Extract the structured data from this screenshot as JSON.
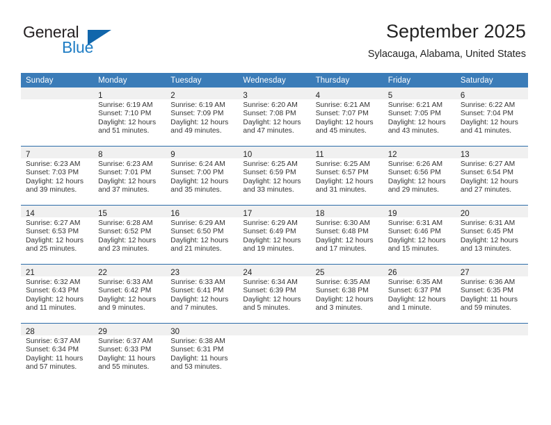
{
  "brand": {
    "name_top": "General",
    "name_bottom": "Blue",
    "accent_color": "#1166ab",
    "text_color": "#231f20"
  },
  "header": {
    "title": "September 2025",
    "location": "Sylacauga, Alabama, United States"
  },
  "theme": {
    "header_row_bg": "#3b7cb8",
    "row_divider": "#2a6ba8",
    "daynum_band_bg": "#f0f0f0",
    "body_text": "#333333"
  },
  "weekday_headers": [
    "Sunday",
    "Monday",
    "Tuesday",
    "Wednesday",
    "Thursday",
    "Friday",
    "Saturday"
  ],
  "weeks": [
    [
      {
        "day": "",
        "sunrise": "",
        "sunset": "",
        "daylight_1": "",
        "daylight_2": ""
      },
      {
        "day": "1",
        "sunrise": "Sunrise: 6:19 AM",
        "sunset": "Sunset: 7:10 PM",
        "daylight_1": "Daylight: 12 hours",
        "daylight_2": "and 51 minutes."
      },
      {
        "day": "2",
        "sunrise": "Sunrise: 6:19 AM",
        "sunset": "Sunset: 7:09 PM",
        "daylight_1": "Daylight: 12 hours",
        "daylight_2": "and 49 minutes."
      },
      {
        "day": "3",
        "sunrise": "Sunrise: 6:20 AM",
        "sunset": "Sunset: 7:08 PM",
        "daylight_1": "Daylight: 12 hours",
        "daylight_2": "and 47 minutes."
      },
      {
        "day": "4",
        "sunrise": "Sunrise: 6:21 AM",
        "sunset": "Sunset: 7:07 PM",
        "daylight_1": "Daylight: 12 hours",
        "daylight_2": "and 45 minutes."
      },
      {
        "day": "5",
        "sunrise": "Sunrise: 6:21 AM",
        "sunset": "Sunset: 7:05 PM",
        "daylight_1": "Daylight: 12 hours",
        "daylight_2": "and 43 minutes."
      },
      {
        "day": "6",
        "sunrise": "Sunrise: 6:22 AM",
        "sunset": "Sunset: 7:04 PM",
        "daylight_1": "Daylight: 12 hours",
        "daylight_2": "and 41 minutes."
      }
    ],
    [
      {
        "day": "7",
        "sunrise": "Sunrise: 6:23 AM",
        "sunset": "Sunset: 7:03 PM",
        "daylight_1": "Daylight: 12 hours",
        "daylight_2": "and 39 minutes."
      },
      {
        "day": "8",
        "sunrise": "Sunrise: 6:23 AM",
        "sunset": "Sunset: 7:01 PM",
        "daylight_1": "Daylight: 12 hours",
        "daylight_2": "and 37 minutes."
      },
      {
        "day": "9",
        "sunrise": "Sunrise: 6:24 AM",
        "sunset": "Sunset: 7:00 PM",
        "daylight_1": "Daylight: 12 hours",
        "daylight_2": "and 35 minutes."
      },
      {
        "day": "10",
        "sunrise": "Sunrise: 6:25 AM",
        "sunset": "Sunset: 6:59 PM",
        "daylight_1": "Daylight: 12 hours",
        "daylight_2": "and 33 minutes."
      },
      {
        "day": "11",
        "sunrise": "Sunrise: 6:25 AM",
        "sunset": "Sunset: 6:57 PM",
        "daylight_1": "Daylight: 12 hours",
        "daylight_2": "and 31 minutes."
      },
      {
        "day": "12",
        "sunrise": "Sunrise: 6:26 AM",
        "sunset": "Sunset: 6:56 PM",
        "daylight_1": "Daylight: 12 hours",
        "daylight_2": "and 29 minutes."
      },
      {
        "day": "13",
        "sunrise": "Sunrise: 6:27 AM",
        "sunset": "Sunset: 6:54 PM",
        "daylight_1": "Daylight: 12 hours",
        "daylight_2": "and 27 minutes."
      }
    ],
    [
      {
        "day": "14",
        "sunrise": "Sunrise: 6:27 AM",
        "sunset": "Sunset: 6:53 PM",
        "daylight_1": "Daylight: 12 hours",
        "daylight_2": "and 25 minutes."
      },
      {
        "day": "15",
        "sunrise": "Sunrise: 6:28 AM",
        "sunset": "Sunset: 6:52 PM",
        "daylight_1": "Daylight: 12 hours",
        "daylight_2": "and 23 minutes."
      },
      {
        "day": "16",
        "sunrise": "Sunrise: 6:29 AM",
        "sunset": "Sunset: 6:50 PM",
        "daylight_1": "Daylight: 12 hours",
        "daylight_2": "and 21 minutes."
      },
      {
        "day": "17",
        "sunrise": "Sunrise: 6:29 AM",
        "sunset": "Sunset: 6:49 PM",
        "daylight_1": "Daylight: 12 hours",
        "daylight_2": "and 19 minutes."
      },
      {
        "day": "18",
        "sunrise": "Sunrise: 6:30 AM",
        "sunset": "Sunset: 6:48 PM",
        "daylight_1": "Daylight: 12 hours",
        "daylight_2": "and 17 minutes."
      },
      {
        "day": "19",
        "sunrise": "Sunrise: 6:31 AM",
        "sunset": "Sunset: 6:46 PM",
        "daylight_1": "Daylight: 12 hours",
        "daylight_2": "and 15 minutes."
      },
      {
        "day": "20",
        "sunrise": "Sunrise: 6:31 AM",
        "sunset": "Sunset: 6:45 PM",
        "daylight_1": "Daylight: 12 hours",
        "daylight_2": "and 13 minutes."
      }
    ],
    [
      {
        "day": "21",
        "sunrise": "Sunrise: 6:32 AM",
        "sunset": "Sunset: 6:43 PM",
        "daylight_1": "Daylight: 12 hours",
        "daylight_2": "and 11 minutes."
      },
      {
        "day": "22",
        "sunrise": "Sunrise: 6:33 AM",
        "sunset": "Sunset: 6:42 PM",
        "daylight_1": "Daylight: 12 hours",
        "daylight_2": "and 9 minutes."
      },
      {
        "day": "23",
        "sunrise": "Sunrise: 6:33 AM",
        "sunset": "Sunset: 6:41 PM",
        "daylight_1": "Daylight: 12 hours",
        "daylight_2": "and 7 minutes."
      },
      {
        "day": "24",
        "sunrise": "Sunrise: 6:34 AM",
        "sunset": "Sunset: 6:39 PM",
        "daylight_1": "Daylight: 12 hours",
        "daylight_2": "and 5 minutes."
      },
      {
        "day": "25",
        "sunrise": "Sunrise: 6:35 AM",
        "sunset": "Sunset: 6:38 PM",
        "daylight_1": "Daylight: 12 hours",
        "daylight_2": "and 3 minutes."
      },
      {
        "day": "26",
        "sunrise": "Sunrise: 6:35 AM",
        "sunset": "Sunset: 6:37 PM",
        "daylight_1": "Daylight: 12 hours",
        "daylight_2": "and 1 minute."
      },
      {
        "day": "27",
        "sunrise": "Sunrise: 6:36 AM",
        "sunset": "Sunset: 6:35 PM",
        "daylight_1": "Daylight: 11 hours",
        "daylight_2": "and 59 minutes."
      }
    ],
    [
      {
        "day": "28",
        "sunrise": "Sunrise: 6:37 AM",
        "sunset": "Sunset: 6:34 PM",
        "daylight_1": "Daylight: 11 hours",
        "daylight_2": "and 57 minutes."
      },
      {
        "day": "29",
        "sunrise": "Sunrise: 6:37 AM",
        "sunset": "Sunset: 6:33 PM",
        "daylight_1": "Daylight: 11 hours",
        "daylight_2": "and 55 minutes."
      },
      {
        "day": "30",
        "sunrise": "Sunrise: 6:38 AM",
        "sunset": "Sunset: 6:31 PM",
        "daylight_1": "Daylight: 11 hours",
        "daylight_2": "and 53 minutes."
      },
      {
        "day": "",
        "sunrise": "",
        "sunset": "",
        "daylight_1": "",
        "daylight_2": ""
      },
      {
        "day": "",
        "sunrise": "",
        "sunset": "",
        "daylight_1": "",
        "daylight_2": ""
      },
      {
        "day": "",
        "sunrise": "",
        "sunset": "",
        "daylight_1": "",
        "daylight_2": ""
      },
      {
        "day": "",
        "sunrise": "",
        "sunset": "",
        "daylight_1": "",
        "daylight_2": ""
      }
    ]
  ]
}
